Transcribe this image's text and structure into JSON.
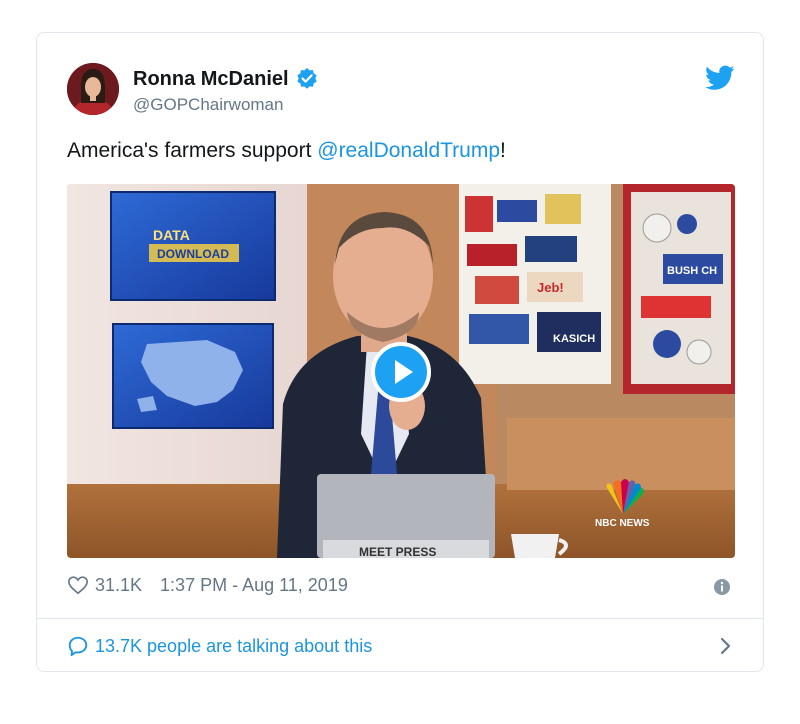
{
  "tweet": {
    "author_name": "Ronna McDaniel",
    "handle": "@GOPChairwoman",
    "text_prefix": "America's farmers support ",
    "mention": "@realDonaldTrump",
    "text_suffix": "!",
    "likes": "31.1K",
    "timestamp": "1:37 PM - Aug 11, 2019",
    "talking": "13.7K people are talking about this"
  },
  "media": {
    "screen_top_line1": "DATA",
    "screen_top_line2": "DOWNLOAD",
    "poster_label": "KASICH",
    "poster_label2": "Jeb!",
    "poster_label3": "KASICH",
    "sign_label": "BUSH CH",
    "network_label": "NBC NEWS",
    "laptop_label": "MEET PRESS"
  },
  "colors": {
    "twitter_blue": "#1da1f2",
    "link_blue": "#1b95e0",
    "meta_gray": "#657786"
  },
  "icons": {
    "verified": "verified-badge-icon",
    "bird": "twitter-bird-icon",
    "heart": "heart-icon",
    "info": "info-icon",
    "bubble": "speech-bubble-icon",
    "chevron": "chevron-right-icon",
    "play": "play-icon"
  }
}
